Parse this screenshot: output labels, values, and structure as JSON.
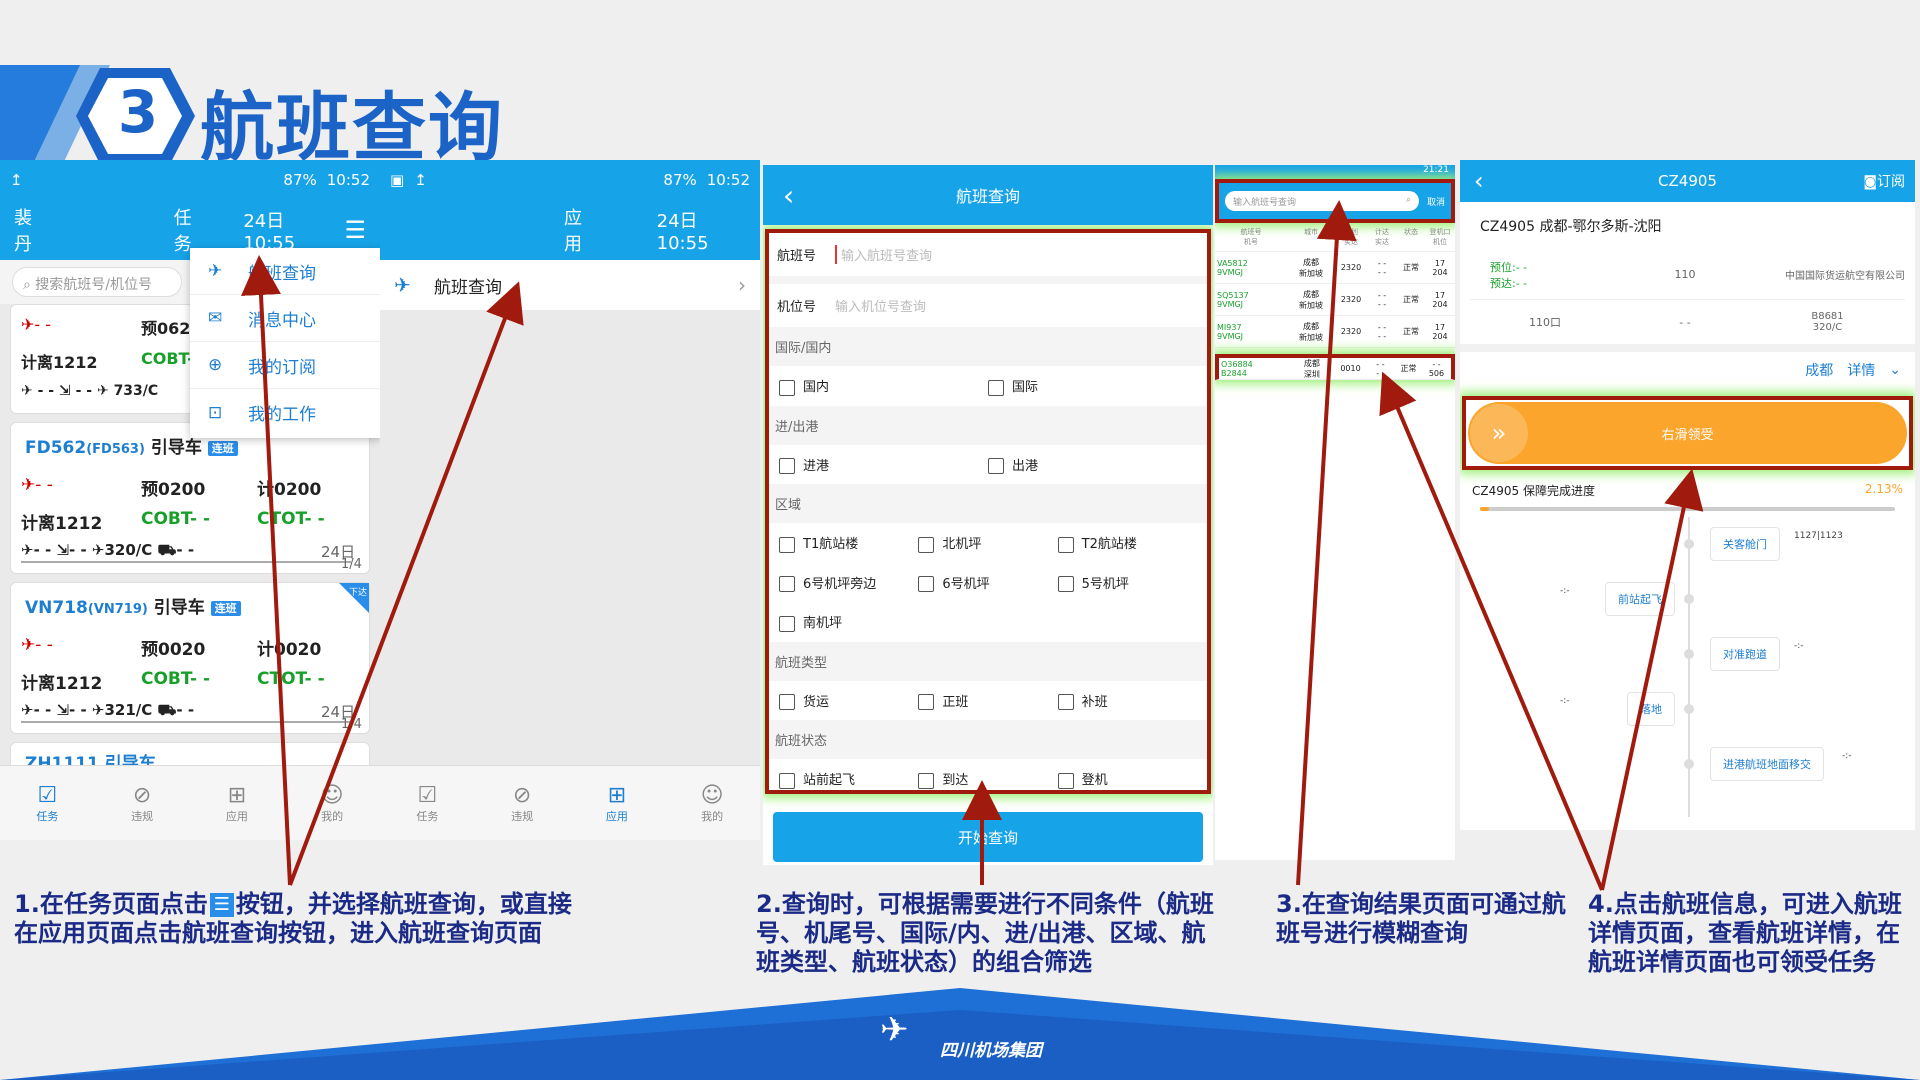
{
  "slide": {
    "step_number": "3",
    "title": "航班查询"
  },
  "colors": {
    "app_blue": "#16a3e8",
    "arrow_red": "#a11a0e",
    "caption_blue": "#1b2a86",
    "orange": "#fba52d",
    "glow": "#9ff07a"
  },
  "s1": {
    "status_time": "10:52",
    "status_battery": "87%",
    "user": "裴丹",
    "tab": "任务",
    "date_time": "24日 10:55",
    "search_placeholder": "搜索航班号/机位号",
    "menu": [
      "航班查询",
      "消息中心",
      "我的订阅",
      "我的工作"
    ],
    "card0": {
      "pre": "预062",
      "plan": "计离1212",
      "cobt": "COBT-",
      "dash": "- -",
      "sub": "733/C"
    },
    "card1": {
      "flight": "FD562",
      "pair": "(FD563)",
      "vehicle": "引导车",
      "badge": "连班",
      "pre": "预0200",
      "plan2": "计0200",
      "plan": "计离1212",
      "cobt": "COBT- -",
      "ctot": "CTOT- -",
      "type": "320/C",
      "date": "24日",
      "page": "1/4"
    },
    "card2": {
      "flight": "VN718",
      "pair": "(VN719)",
      "vehicle": "引导车",
      "badge": "连班",
      "pre": "预0020",
      "plan2": "计0020",
      "plan": "计离1212",
      "cobt": "COBT- -",
      "ctot": "CTOT- -",
      "type": "321/C",
      "date": "24日",
      "page": "1/4",
      "corner": "下达"
    },
    "card3_fragment": "ZH1111 引导车",
    "nav": [
      "任务",
      "违规",
      "应用",
      "我的"
    ]
  },
  "s2": {
    "status_time": "10:52",
    "status_battery": "87%",
    "tab": "应用",
    "date_time": "24日 10:55",
    "item": "航班查询",
    "nav": [
      "任务",
      "违规",
      "应用",
      "我的"
    ]
  },
  "s3": {
    "title": "航班查询",
    "f1_label": "航班号",
    "f1_ph": "输入航班号查询",
    "f2_label": "机位号",
    "f2_ph": "输入机位号查询",
    "sections": [
      {
        "h": "国际/国内",
        "opts": [
          "国内",
          "国际"
        ]
      },
      {
        "h": "进/出港",
        "opts": [
          "进港",
          "出港"
        ]
      },
      {
        "h": "区域",
        "opts": [
          "T1航站楼",
          "北机坪",
          "T2航站楼",
          "6号机坪旁边",
          "6号机坪",
          "5号机坪",
          "南机坪"
        ]
      },
      {
        "h": "航班类型",
        "opts": [
          "货运",
          "正班",
          "补班"
        ]
      },
      {
        "h": "航班状态",
        "opts": [
          "站前起飞",
          "到达",
          "登机"
        ]
      }
    ],
    "button": "开始查询"
  },
  "s4": {
    "status_time": "21:21",
    "search_ph": "输入航班号查询",
    "cancel": "取消",
    "headers": [
      "航班号\n机号",
      "城市",
      "计划\n实达",
      "计达\n实达",
      "状态",
      "登机口\n机位"
    ],
    "rows": [
      {
        "f": "VA5812",
        "r": "9VMGJ",
        "c": "成都\n新加坡",
        "t": "2320",
        "s": "正常",
        "g": "17\n204"
      },
      {
        "f": "SQ5137",
        "r": "9VMGJ",
        "c": "成都\n新加坡",
        "t": "2320",
        "s": "正常",
        "g": "17\n204"
      },
      {
        "f": "MI937",
        "r": "9VMGJ",
        "c": "成都\n新加坡",
        "t": "2320",
        "s": "正常",
        "g": "17\n204"
      },
      {
        "f": "O36884",
        "r": "B2844",
        "c": "成都\n深圳",
        "t": "0010",
        "s": "正常",
        "g": "- -\n506"
      }
    ]
  },
  "s5": {
    "title": "CZ4905",
    "subscribe": "订阅",
    "route": "CZ4905  成都-鄂尔多斯-沈阳",
    "pre": "预位:- -",
    "pre2": "预达:- -",
    "stand": "110",
    "company": "中国国际货运航空有限公司",
    "gate": "110口",
    "dash": "- -",
    "reg": "B8681",
    "type": "320/C",
    "city": "成都",
    "detail": "详情",
    "slide": "右滑领受",
    "progress_label": "CZ4905 保障完成进度",
    "progress_value": "2.13%",
    "progress_fraction": 0.0213,
    "timeline": [
      {
        "t": "关客舱门",
        "side": "r",
        "note": "1127|1123"
      },
      {
        "t": "前站起飞",
        "side": "l",
        "note": "-:-"
      },
      {
        "t": "对准跑道",
        "side": "r",
        "note": "-:-"
      },
      {
        "t": "落地",
        "side": "l",
        "note": "-:-"
      },
      {
        "t": "进港航班地面移交",
        "side": "r",
        "note": "-:-"
      }
    ]
  },
  "captions": [
    "1.在任务页面点击",
    "按钮，并选择航班查询，或直接在应用页面点击航班查询按钮，进入航班查询页面",
    "2.查询时，可根据需要进行不同条件（航班号、机尾号、国际/内、进/出港、区域、航班类型、航班状态）的组合筛选",
    "3.在查询结果页面可通过航班号进行模糊查询",
    "4.点击航班信息，可进入航班详情页面，查看航班详情，在航班详情页面也可领受任务"
  ],
  "footer": {
    "logo_text": "四川机场集团"
  }
}
